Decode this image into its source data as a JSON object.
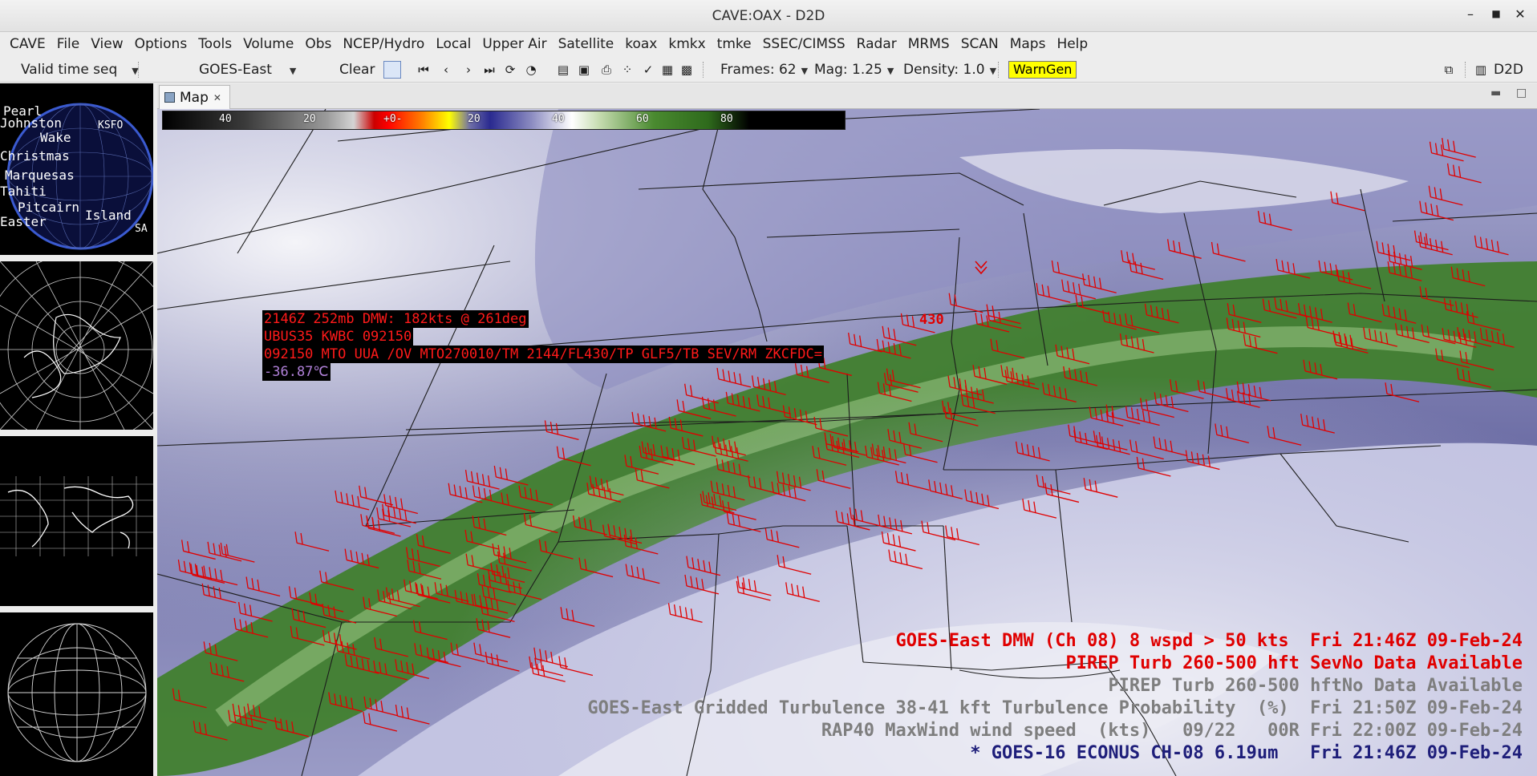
{
  "window": {
    "title": "CAVE:OAX - D2D"
  },
  "menu": [
    "CAVE",
    "File",
    "View",
    "Options",
    "Tools",
    "Volume",
    "Obs",
    "NCEP/Hydro",
    "Local",
    "Upper Air",
    "Satellite",
    "koax",
    "kmkx",
    "tmke",
    "SSEC/CIMSS",
    "Radar",
    "MRMS",
    "SCAN",
    "Maps",
    "Help"
  ],
  "toolbar": {
    "time_mode": "Valid time seq",
    "source": "GOES-East",
    "clear_label": "Clear",
    "frames_label": "Frames: 62",
    "mag_label": "Mag: 1.25",
    "density_label": "Density: 1.0",
    "warngen_label": "WarnGen",
    "perspective_label": "D2D"
  },
  "tab": {
    "label": "Map"
  },
  "colorbar": {
    "ticks": [
      "40",
      "20",
      "+0-",
      "20",
      "40",
      "60",
      "80"
    ]
  },
  "panes": {
    "globe_labels": [
      "Pearl",
      "Johnston",
      "KSFO",
      "Wake",
      "Christmas",
      "Marquesas",
      "Tahiti",
      "Pitcairn",
      "Easter",
      "Island",
      "SA"
    ]
  },
  "sample": {
    "line1": "2146Z 252mb DMW: 182kts @ 261deg",
    "line2": "UBUS35 KWBC 092150",
    "line3": "092150 MTO UUA /OV MTO270010/TM 2144/FL430/TP GLF5/TB SEV/RM ZKCFDC=",
    "line4": "-36.87℃"
  },
  "flight_level": "430",
  "legend": {
    "l1": "GOES-East DMW (Ch 08) 8 wspd > 50 kts  Fri 21:46Z 09-Feb-24",
    "l2": "PIREP Turb 260-500 hft SevNo Data Available",
    "l3": "PIREP Turb 260-500 hftNo Data Available",
    "l4": "GOES-East Gridded Turbulence 38-41 kft Turbulence Probability  (%)  Fri 21:50Z 09-Feb-24",
    "l5": "RAP40 MaxWind wind speed  (kts)   09/22   00R Fri 22:00Z 09-Feb-24",
    "l6": "* GOES-16 ECONUS CH-08 6.19um   Fri 21:46Z 09-Feb-24"
  },
  "colors": {
    "warngen": "#ffff00",
    "overlay_red": "#e00000",
    "moist_green": "#3f7f2a",
    "dry_purple": "#6b6ca6"
  }
}
